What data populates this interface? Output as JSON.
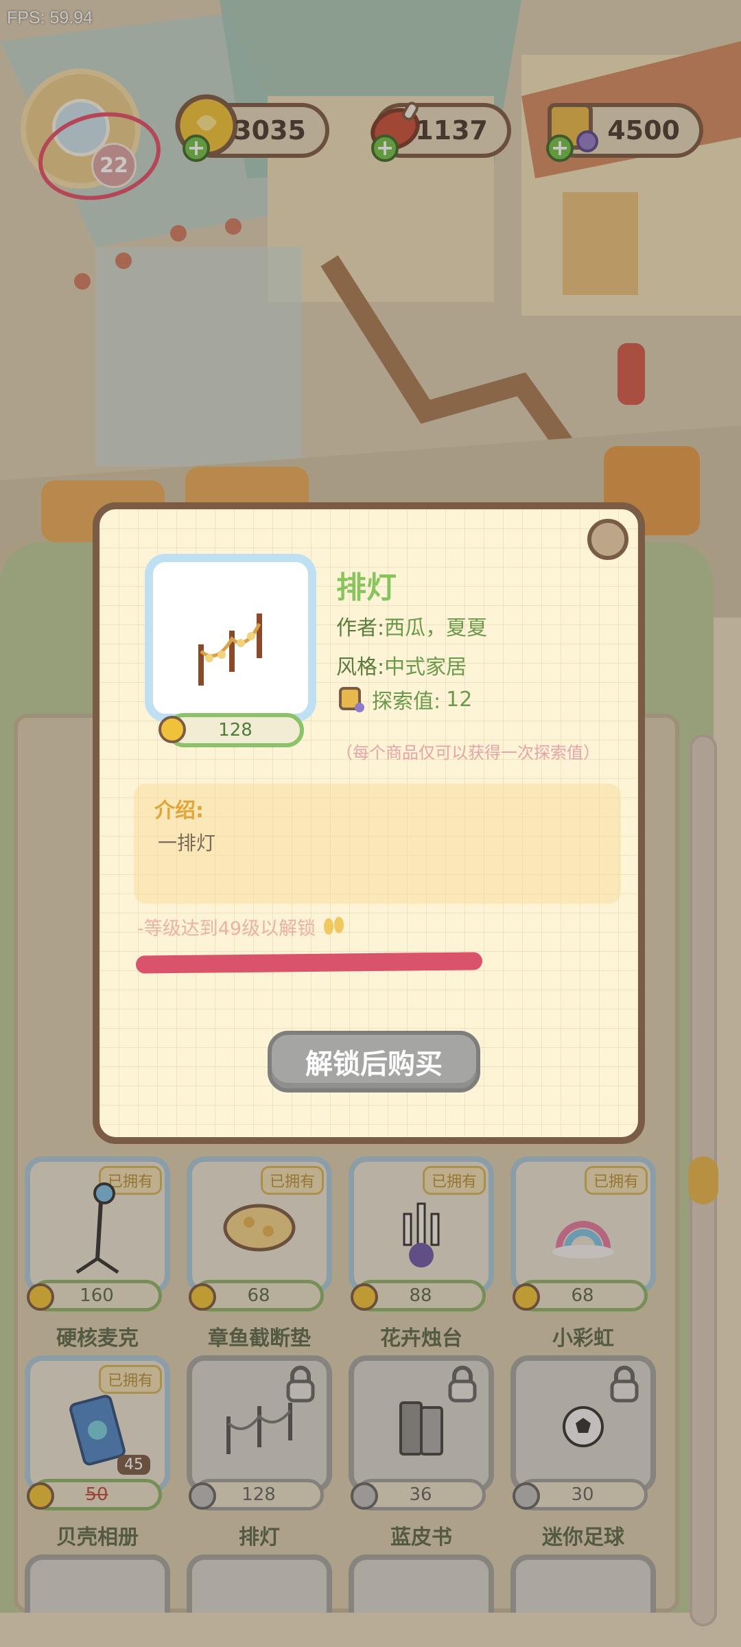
{
  "fps_label": "FPS: 59.94",
  "player": {
    "level": "22"
  },
  "resources": [
    {
      "name": "coins",
      "icon": "coin-icon",
      "value": "3035"
    },
    {
      "name": "meat",
      "icon": "meat-icon",
      "value": "1137"
    },
    {
      "name": "explore-book",
      "icon": "book-icon",
      "value": "4500"
    }
  ],
  "modal": {
    "title": "排灯",
    "author_label": "作者:",
    "author": "西瓜，夏夏",
    "style_label": "风格:",
    "style": "中式家居",
    "explore_label": "探索值:",
    "explore_value": "12",
    "note": "（每个商品仅可以获得一次探索值）",
    "price": "128",
    "intro_label": "介绍:",
    "intro_text": "一排灯",
    "unlock_requirement": "-等级达到49级以解锁",
    "buy_button": "解锁后购买"
  },
  "shop": {
    "owned_tag": "已拥有",
    "row1": [
      {
        "name": "硬核麦克",
        "price": "160",
        "owned": true,
        "icon": "microphone-icon"
      },
      {
        "name": "章鱼截断垫",
        "price": "68",
        "owned": true,
        "icon": "cushion-icon"
      },
      {
        "name": "花卉烛台",
        "price": "88",
        "owned": true,
        "icon": "candelabra-icon"
      },
      {
        "name": "小彩虹",
        "price": "68",
        "owned": true,
        "icon": "rainbow-icon"
      }
    ],
    "row2": [
      {
        "name": "贝壳相册",
        "price": "50",
        "owned": true,
        "discount": "45",
        "icon": "album-icon"
      },
      {
        "name": "排灯",
        "price": "128",
        "owned": false,
        "icon": "lamp-row-icon"
      },
      {
        "name": "蓝皮书",
        "price": "36",
        "owned": false,
        "icon": "books-icon"
      },
      {
        "name": "迷你足球",
        "price": "30",
        "owned": false,
        "icon": "soccer-ball-icon"
      }
    ]
  },
  "colors": {
    "accent_green": "#88c45e",
    "lock_red": "#d9546b",
    "frame_brown": "#7a5b45"
  }
}
